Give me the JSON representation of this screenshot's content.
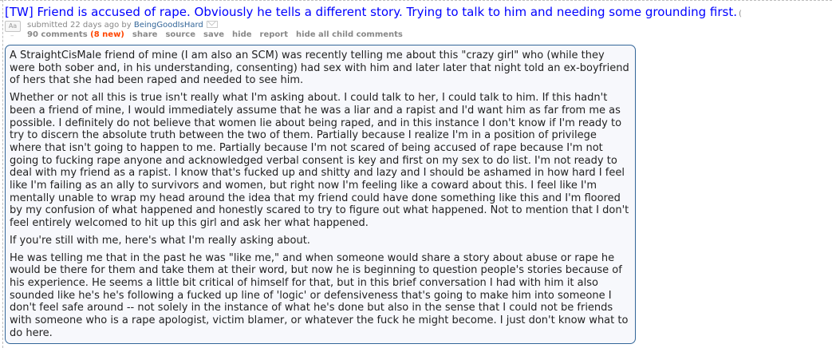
{
  "post": {
    "title": "[TW] Friend is accused of rape. Obviously he tells a different story. Trying to talk to him and needing some grounding first.",
    "title_tail": "(",
    "thumbnail_text": "Aa",
    "thumbnail_dash": "–",
    "submitted_prefix": "submitted",
    "submitted_time": "22 days ago",
    "submitted_by": "by",
    "author": "BeingGoodIsHard",
    "comments_label": "90 comments",
    "new_count": "(8 new)",
    "buttons": {
      "share": "share",
      "source": "source",
      "save": "save",
      "hide": "hide",
      "report": "report",
      "hide_children": "hide all child comments"
    },
    "body": [
      "A StraightCisMale friend of mine (I am also an SCM) was recently telling me about this \"crazy girl\" who (while they were both sober and, in his understanding, consenting) had sex with him and later later that night told an ex-boyfriend of hers that she had been raped and needed to see him.",
      "Whether or not all this is true isn't really what I'm asking about. I could talk to her, I could talk to him. If this hadn't been a friend of mine, I would immediately assume that he was a liar and a rapist and I'd want him as far from me as possible. I definitely do not believe that women lie about being raped, and in this instance I don't know if I'm ready to try to discern the absolute truth between the two of them. Partially because I realize I'm in a position of privilege where that isn't going to happen to me. Partially because I'm not scared of being accused of rape because I'm not going to fucking rape anyone and acknowledged verbal consent is key and first on my sex to do list. I'm not ready to deal with my friend as a rapist. I know that's fucked up and shitty and lazy and I should be ashamed in how hard I feel like I'm failing as an ally to survivors and women, but right now I'm feeling like a coward about this. I feel like I'm mentally unable to wrap my head around the idea that my friend could have done something like this and I'm floored by my confusion of what happened and honestly scared to try to figure out what happened. Not to mention that I don't feel entirely welcomed to hit up this girl and ask her what happened.",
      "If you're still with me, here's what I'm really asking about.",
      "He was telling me that in the past he was \"like me,\" and when someone would share a story about abuse or rape he would be there for them and take them at their word, but now he is beginning to question people's stories because of his experience. He seems a little bit critical of himself for that, but in this brief conversation I had with him it also sounded like he's he's following a fucked up line of 'logic' or defensiveness that's going to make him into someone I don't feel safe around -- not solely in the instance of what he's done but also in the sense that I could not be friends with someone who is a rape apologist, victim blamer, or whatever the fuck he might become. I just don't know what to do here."
    ]
  },
  "colors": {
    "title": "#0000ff",
    "author": "#336699",
    "new": "#ff4500",
    "body_bg": "#f7f8fc",
    "body_border": "#336699"
  }
}
